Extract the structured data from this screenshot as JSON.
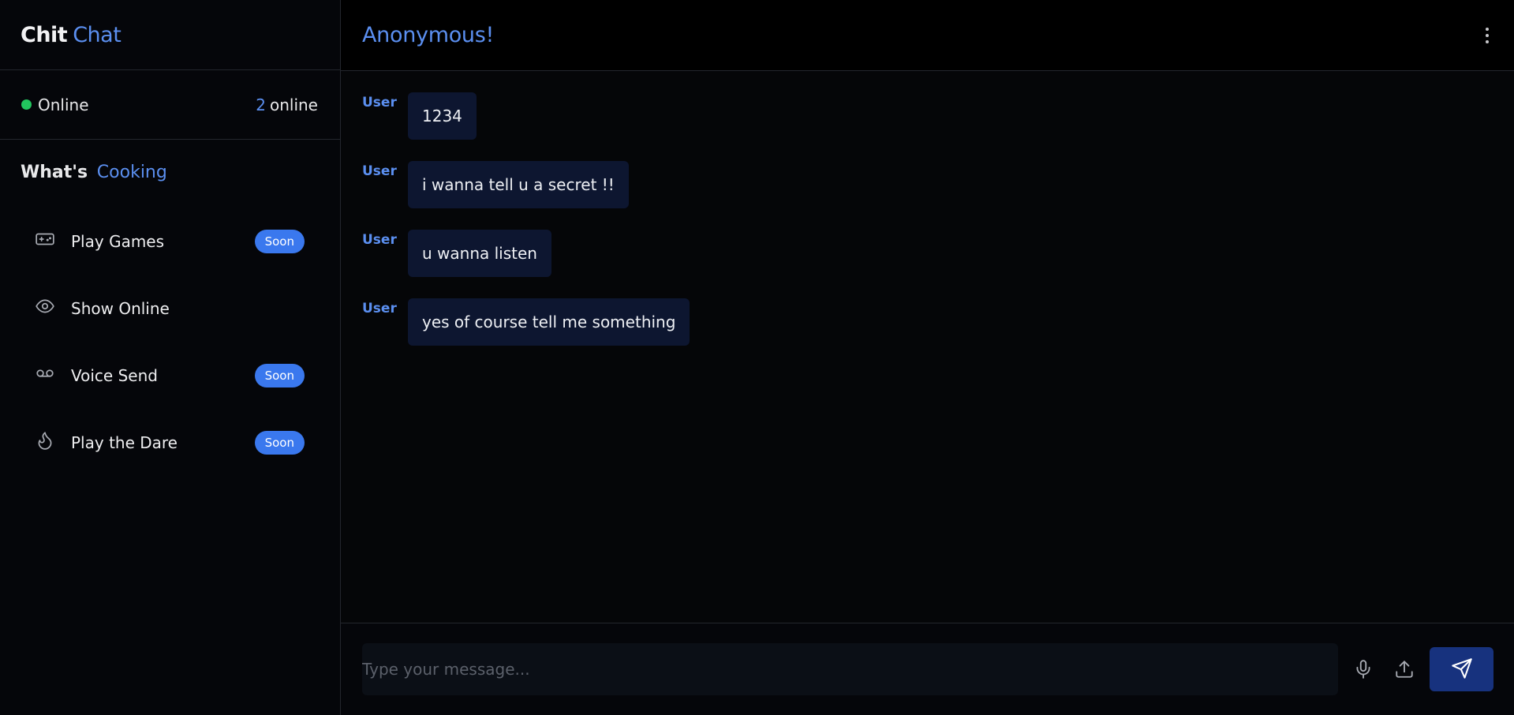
{
  "brand": {
    "part1": "Chit",
    "part2": "Chat",
    "accent": "#5b8ff0"
  },
  "status": {
    "label": "Online",
    "count": "2",
    "count_suffix": "online",
    "dot_color": "#22c55e"
  },
  "section": {
    "title_part1": "What's",
    "title_part2": "Cooking"
  },
  "features": [
    {
      "label": "Play Games",
      "icon": "gamepad-icon",
      "badge": "Soon"
    },
    {
      "label": "Show Online",
      "icon": "eye-icon",
      "badge": ""
    },
    {
      "label": "Voice Send",
      "icon": "voicemail-icon",
      "badge": "Soon"
    },
    {
      "label": "Play the Dare",
      "icon": "flame-icon",
      "badge": "Soon"
    }
  ],
  "chat": {
    "title": "Anonymous!",
    "messages": [
      {
        "user": "User",
        "text": "1234"
      },
      {
        "user": "User",
        "text": "i wanna tell u a secret !!"
      },
      {
        "user": "User",
        "text": "u wanna listen"
      },
      {
        "user": "User",
        "text": "yes of course tell me something"
      }
    ]
  },
  "composer": {
    "placeholder": "Type your message..."
  }
}
